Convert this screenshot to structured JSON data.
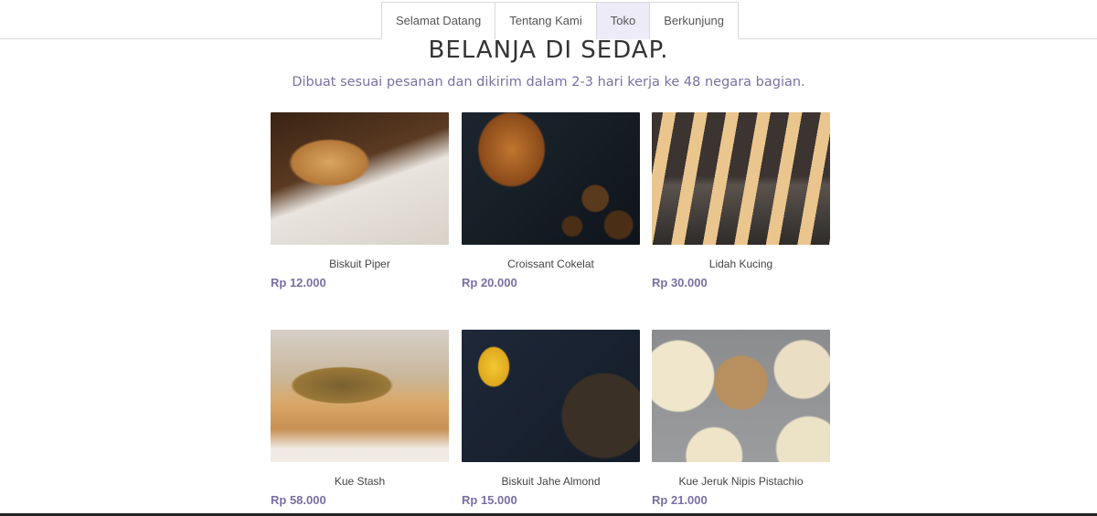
{
  "nav": {
    "tabs": [
      {
        "label": "Selamat Datang"
      },
      {
        "label": "Tentang Kami"
      },
      {
        "label": "Toko"
      },
      {
        "label": "Berkunjung"
      }
    ]
  },
  "main": {
    "title": "BELANJA DI SEDAP.",
    "subtitle": "Dibuat sesuai pesanan dan dikirim dalam 2-3 hari kerja ke 48 negara bagian."
  },
  "products": [
    {
      "name": "Biskuit Piper",
      "price": "Rp 12.000"
    },
    {
      "name": "Croissant Cokelat",
      "price": "Rp 20.000"
    },
    {
      "name": "Lidah Kucing",
      "price": "Rp 30.000"
    },
    {
      "name": "Kue Stash",
      "price": "Rp 58.000"
    },
    {
      "name": "Biskuit Jahe Almond",
      "price": "Rp 15.000"
    },
    {
      "name": "Kue Jeruk Nipis Pistachio",
      "price": "Rp 21.000"
    }
  ],
  "colors": {
    "accent": "#7a6fa3",
    "active_tab": "#ecebf7"
  }
}
